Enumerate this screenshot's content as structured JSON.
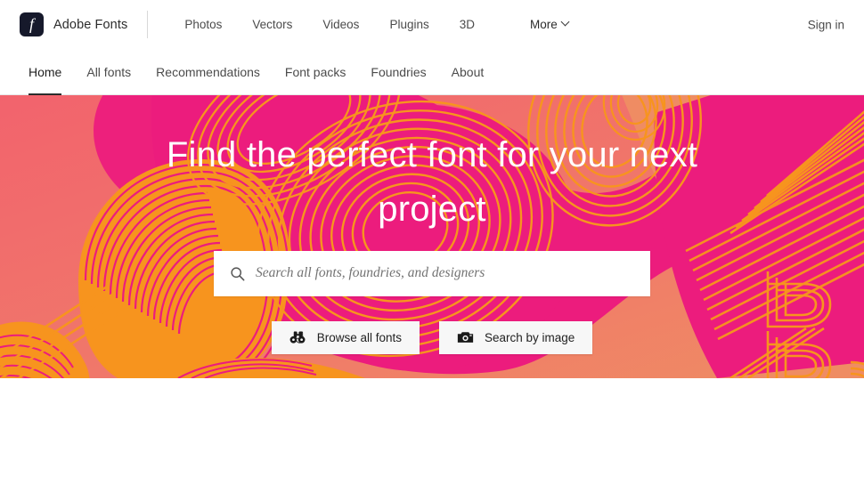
{
  "header": {
    "brand_name": "Adobe Fonts",
    "logo_glyph": "f",
    "logo_icon_name": "adobe-fonts-logo",
    "nav": [
      {
        "label": "Photos"
      },
      {
        "label": "Vectors"
      },
      {
        "label": "Videos"
      },
      {
        "label": "Plugins"
      },
      {
        "label": "3D"
      }
    ],
    "more_label": "More",
    "sign_in_label": "Sign in"
  },
  "subnav": {
    "items": [
      {
        "label": "Home",
        "active": true
      },
      {
        "label": "All fonts",
        "active": false
      },
      {
        "label": "Recommendations",
        "active": false
      },
      {
        "label": "Font packs",
        "active": false
      },
      {
        "label": "Foundries",
        "active": false
      },
      {
        "label": "About",
        "active": false
      }
    ]
  },
  "hero": {
    "title": "Find the perfect font for your next project",
    "search": {
      "placeholder": "Search all fonts, foundries, and designers",
      "value": "",
      "icon": "search-icon"
    },
    "buttons": [
      {
        "label": "Browse all fonts",
        "icon": "binoculars-icon"
      },
      {
        "label": "Search by image",
        "icon": "camera-icon"
      }
    ]
  },
  "colors": {
    "coral": "#F2686F",
    "peach": "#F08A62",
    "magenta": "#EC1C7D",
    "orange": "#F7941E",
    "logo_navy": "#16192B",
    "text_dark": "#2C2C2C",
    "text_gray": "#4B4B4B",
    "page_bg": "#FFFFFF"
  }
}
